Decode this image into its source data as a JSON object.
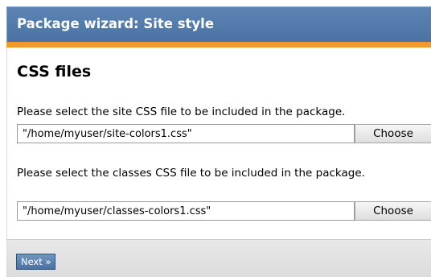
{
  "header": {
    "title": "Package wizard: Site style"
  },
  "main": {
    "heading": "CSS files",
    "site_css": {
      "prompt": "Please select the site CSS file to be included in the package.",
      "value": "\"/home/myuser/site-colors1.css\"",
      "choose_label": "Choose"
    },
    "classes_css": {
      "prompt": "Please select the classes CSS file to be included in the package.",
      "value": "\"/home/myuser/classes-colors1.css\"",
      "choose_label": "Choose"
    }
  },
  "footer": {
    "next_label": "Next »"
  },
  "colors": {
    "header_bg": "#4f77a8",
    "accent_bar": "#f09a2c",
    "footer_bg": "#e3e3e3",
    "next_button_bg": "#5a80b0"
  }
}
